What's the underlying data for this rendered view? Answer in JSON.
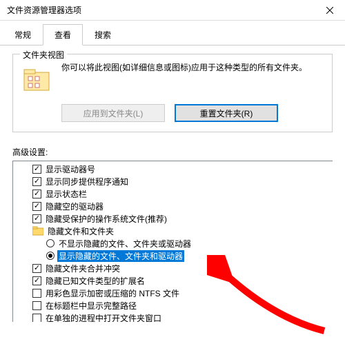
{
  "window": {
    "title": "文件资源管理器选项"
  },
  "tabs": {
    "t0": "常规",
    "t1": "查看",
    "t2": "搜索"
  },
  "folderViews": {
    "title": "文件夹视图",
    "desc": "你可以将此视图(如详细信息或图标)应用于这种类型的所有文件夹。",
    "applyBtn": "应用到文件夹(L)",
    "resetBtn": "重置文件夹(R)"
  },
  "adv": {
    "label": "高级设置:",
    "items": [
      {
        "kind": "check",
        "checked": true,
        "indent": 1,
        "text": "显示驱动器号"
      },
      {
        "kind": "check",
        "checked": true,
        "indent": 1,
        "text": "显示同步提供程序通知"
      },
      {
        "kind": "check",
        "checked": true,
        "indent": 1,
        "text": "显示状态栏"
      },
      {
        "kind": "check",
        "checked": true,
        "indent": 1,
        "text": "隐藏空的驱动器"
      },
      {
        "kind": "check",
        "checked": true,
        "indent": 1,
        "text": "隐藏受保护的操作系统文件(推荐)"
      },
      {
        "kind": "folder",
        "indent": 1,
        "text": "隐藏文件和文件夹"
      },
      {
        "kind": "radio",
        "checked": false,
        "indent": 2,
        "text": "不显示隐藏的文件、文件夹或驱动器"
      },
      {
        "kind": "radio",
        "checked": true,
        "indent": 2,
        "text": "显示隐藏的文件、文件夹和驱动器",
        "selected": true
      },
      {
        "kind": "check",
        "checked": true,
        "indent": 1,
        "text": "隐藏文件夹合并冲突"
      },
      {
        "kind": "check",
        "checked": true,
        "indent": 1,
        "text": "隐藏已知文件类型的扩展名"
      },
      {
        "kind": "check",
        "checked": false,
        "indent": 1,
        "text": "用彩色显示加密或压缩的 NTFS 文件"
      },
      {
        "kind": "check",
        "checked": false,
        "indent": 1,
        "text": "在标题栏中显示完整路径"
      },
      {
        "kind": "check",
        "checked": false,
        "indent": 1,
        "text": "在单独的进程中打开文件夹窗口"
      }
    ]
  }
}
